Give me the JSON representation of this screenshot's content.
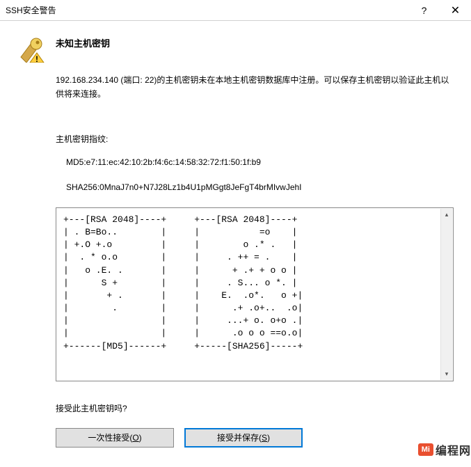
{
  "titlebar": {
    "title": "SSH安全警告"
  },
  "icon": "key-warning-icon",
  "heading": "未知主机密钥",
  "body_text": "192.168.234.140 (端口: 22)的主机密钥未在本地主机密钥数据库中注册。可以保存主机密钥以验证此主机以供将来连接。",
  "fingerprint_label": "主机密钥指纹:",
  "md5_line": "MD5:e7:11:ec:42:10:2b:f4:6c:14:58:32:72:f1:50:1f:b9",
  "sha256_line": "SHA256:0MnaJ7n0+N7J28Lz1b4U1pMGgt8JeFgT4brMIvwJehI",
  "art_md5": "+---[RSA 2048]----+\n| . B=Bo..        |\n| +.O +.o         |\n|  . * o.o        |\n|   o .E. .       |\n|      S +        |\n|       + .       |\n|        .        |\n|                 |\n|                 |\n+------[MD5]------+",
  "art_sha256": "+---[RSA 2048]----+\n|           =o    |\n|        o .* .   |\n|     . ++ = .    |\n|      + .+ + o o |\n|     . S... o *. |\n|    E.  .o*.   o +|\n|      .+ .o+..  .o|\n|     ...+ o. o+o .|\n|      .o o o ==o.o|\n+-----[SHA256]-----+",
  "question": "接受此主机密钥吗?",
  "buttons": {
    "accept_once": "一次性接受(",
    "accept_once_u": "O",
    "accept_once_end": ")",
    "accept_save": "接受并保存(",
    "accept_save_u": "S",
    "accept_save_end": ")"
  },
  "watermark": {
    "badge": "Mi",
    "text": "编程网"
  }
}
